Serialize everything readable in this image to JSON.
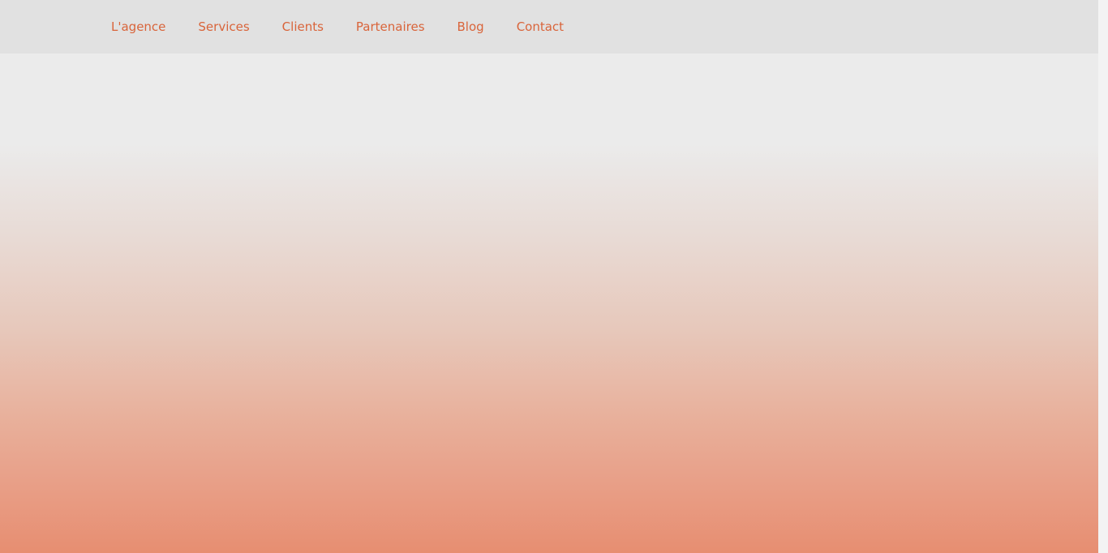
{
  "navigation": {
    "items": [
      {
        "label": "L'agence"
      },
      {
        "label": "Services"
      },
      {
        "label": "Clients"
      },
      {
        "label": "Partenaires"
      },
      {
        "label": "Blog"
      },
      {
        "label": "Contact"
      }
    ]
  },
  "colors": {
    "nav_background": "#e1e1e1",
    "nav_text": "#d9643a",
    "page_background": "#ebebeb",
    "gradient_end": "#e78e71"
  }
}
